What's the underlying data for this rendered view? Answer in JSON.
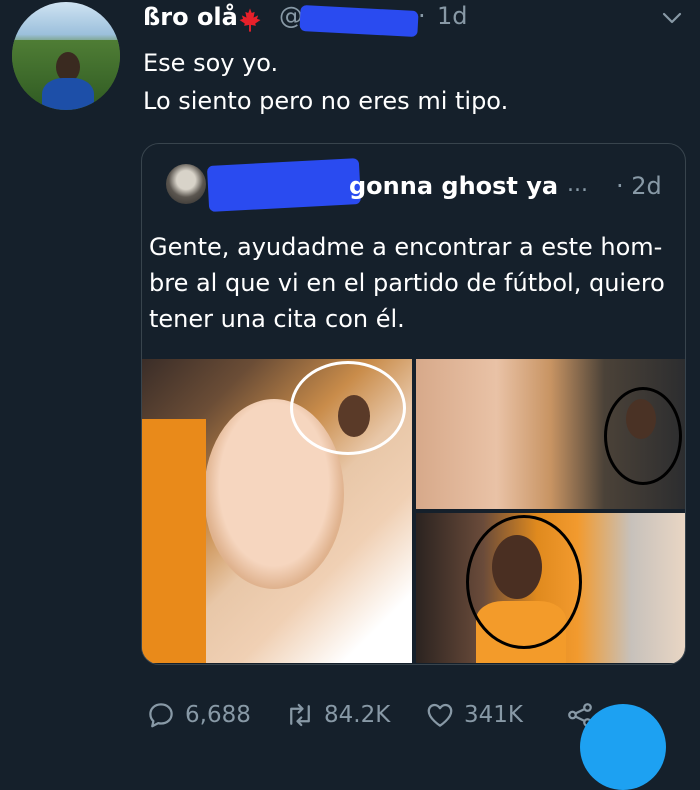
{
  "tweet": {
    "author_name": "ßro olå",
    "handle": "@",
    "dot": "·",
    "time": "1d",
    "text_lines": [
      "Ese soy yo.",
      "Lo siento pero no eres mi tipo."
    ]
  },
  "quoted": {
    "name": "gonna ghost ya",
    "ellipsis": "...",
    "time": "· 2d",
    "text_lines": [
      "Gente, ayudadme a encontrar a este hom-",
      "bre al que vi en el partido de fútbol, quiero",
      "tener una cita con él."
    ]
  },
  "actions": {
    "replies": "6,688",
    "retweets": "84.2K",
    "likes": "341K"
  },
  "icons": {
    "maple": "maple-leaf-icon",
    "chevron": "chevron-down-icon",
    "reply": "reply-icon",
    "retweet": "retweet-icon",
    "like": "heart-icon",
    "share": "share-icon"
  },
  "colors": {
    "background": "#15202b",
    "muted": "#8899a6",
    "accent": "#1da1f2",
    "redaction": "#2a4bf0"
  }
}
